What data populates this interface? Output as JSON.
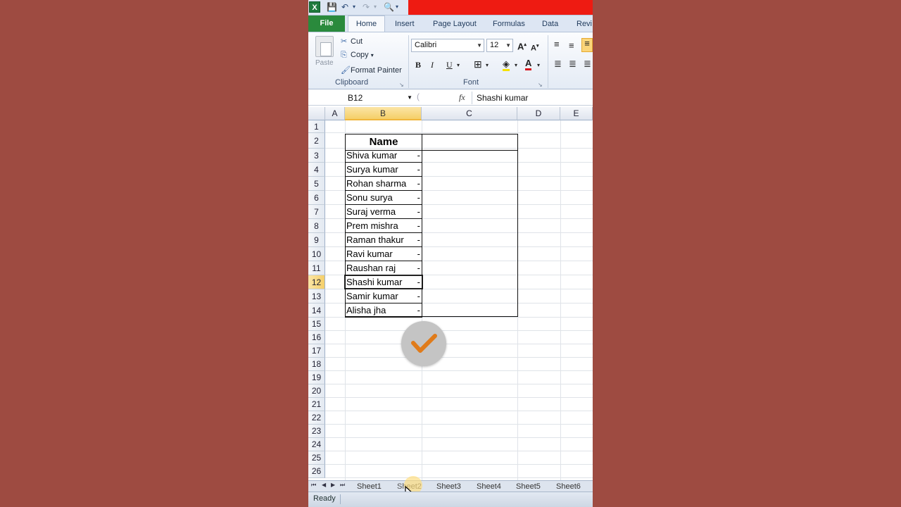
{
  "window": {
    "app_icon": "X"
  },
  "tabs": [
    "File",
    "Home",
    "Insert",
    "Page Layout",
    "Formulas",
    "Data",
    "Revi"
  ],
  "clipboard": {
    "paste": "Paste",
    "cut": "Cut",
    "copy": "Copy",
    "format_painter": "Format Painter",
    "group_label": "Clipboard"
  },
  "font": {
    "family": "Calibri",
    "size": "12",
    "group_label": "Font",
    "bold": "B",
    "italic": "I",
    "underline": "U"
  },
  "formula_bar": {
    "name_box": "B12",
    "fx": "fx",
    "value": "Shashi kumar"
  },
  "columns": [
    "A",
    "B",
    "C",
    "D",
    "E"
  ],
  "rows": [
    "1",
    "2",
    "3",
    "4",
    "5",
    "6",
    "7",
    "8",
    "9",
    "10",
    "11",
    "12",
    "13",
    "14",
    "15",
    "16",
    "17",
    "18",
    "19",
    "20",
    "21",
    "22",
    "23",
    "24",
    "25",
    "26"
  ],
  "table": {
    "header": "Name",
    "names": [
      "Shiva kumar",
      "Surya kumar",
      "Rohan sharma",
      "Sonu surya",
      "Suraj verma",
      "Prem mishra",
      "Raman thakur",
      "Ravi kumar",
      "Raushan raj",
      "Shashi kumar",
      "Samir kumar",
      "Alisha jha"
    ],
    "dash": "-"
  },
  "sheets": [
    "Sheet1",
    "Sheet2",
    "Sheet3",
    "Sheet4",
    "Sheet5",
    "Sheet6"
  ],
  "status": "Ready",
  "colors": {
    "background": "#9e4b41",
    "file_tab": "#2a8a3c",
    "selection_header": "#f5cf68",
    "check_mark": "#e07b1a"
  }
}
